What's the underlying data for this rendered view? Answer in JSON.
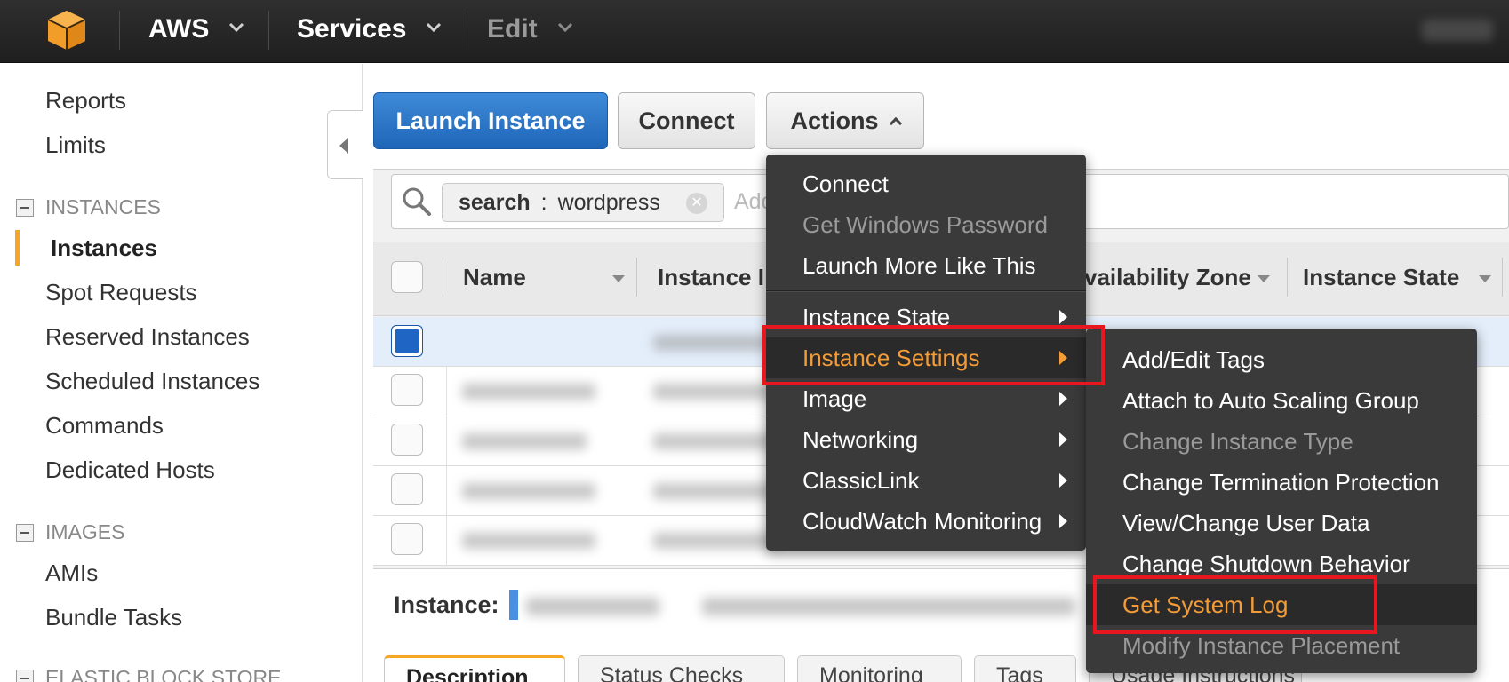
{
  "topbar": {
    "brand_label": "AWS",
    "services_label": "Services",
    "edit_label": "Edit",
    "chevron_glyph": "⌄"
  },
  "sidebar": {
    "items_top": [
      "Reports",
      "Limits"
    ],
    "section_instances": "INSTANCES",
    "instances_items": [
      "Instances",
      "Spot Requests",
      "Reserved Instances",
      "Scheduled Instances",
      "Commands",
      "Dedicated Hosts"
    ],
    "active_item": "Instances",
    "section_images": "IMAGES",
    "images_items": [
      "AMIs",
      "Bundle Tasks"
    ],
    "section_ebs": "ELASTIC BLOCK STORE"
  },
  "toolbar": {
    "launch_label": "Launch Instance",
    "connect_label": "Connect",
    "actions_label": "Actions"
  },
  "search": {
    "token_key": "search",
    "token_sep": ":",
    "token_value": "wordpress",
    "placeholder": "Add"
  },
  "table": {
    "columns": [
      "Name",
      "Instance I",
      "vailability Zone",
      "Instance State"
    ]
  },
  "detail": {
    "instance_label": "Instance:",
    "tabs": [
      "Description",
      "Status Checks",
      "Monitoring",
      "Tags",
      "Usage Instructions"
    ]
  },
  "actions_menu": {
    "items": [
      {
        "label": "Connect",
        "disabled": false
      },
      {
        "label": "Get Windows Password",
        "disabled": true
      },
      {
        "label": "Launch More Like This",
        "disabled": false
      },
      {
        "label": "Instance State",
        "submenu": true
      },
      {
        "label": "Instance Settings",
        "submenu": true,
        "highlighted": true
      },
      {
        "label": "Image",
        "submenu": true
      },
      {
        "label": "Networking",
        "submenu": true
      },
      {
        "label": "ClassicLink",
        "submenu": true
      },
      {
        "label": "CloudWatch Monitoring",
        "submenu": true
      }
    ]
  },
  "settings_menu": {
    "items": [
      {
        "label": "Add/Edit Tags",
        "disabled": false
      },
      {
        "label": "Attach to Auto Scaling Group",
        "disabled": false
      },
      {
        "label": "Change Instance Type",
        "disabled": true
      },
      {
        "label": "Change Termination Protection",
        "disabled": false
      },
      {
        "label": "View/Change User Data",
        "disabled": false
      },
      {
        "label": "Change Shutdown Behavior",
        "disabled": false
      },
      {
        "label": "Get System Log",
        "disabled": false,
        "highlighted": true
      },
      {
        "label": "Modify Instance Placement",
        "disabled": true
      }
    ]
  },
  "colors": {
    "accent_orange": "#f39c38",
    "highlight_red": "#e8161f",
    "primary_blue": "#1f66b8"
  }
}
